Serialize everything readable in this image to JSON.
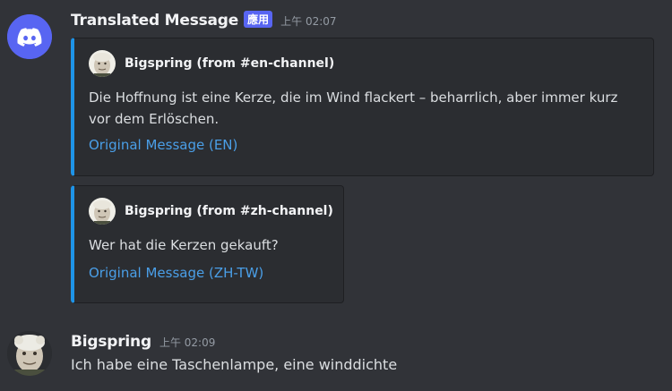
{
  "bot_message": {
    "username": "Translated Message",
    "badge": "應用",
    "timestamp": "上午 02:07",
    "avatar_icon": "discord-logo-icon",
    "embeds": [
      {
        "author": "Bigspring (from #en-channel)",
        "description": "Die Hoffnung ist eine Kerze, die im Wind flackert – beharrlich, aber immer kurz vor dem Erlöschen.",
        "link_text": "Original Message (EN)",
        "accent_color": "#1e94e8"
      },
      {
        "author": "Bigspring (from #zh-channel)",
        "description": "Wer hat die Kerzen gekauft?",
        "link_text": "Original Message (ZH-TW)",
        "accent_color": "#1e94e8"
      }
    ]
  },
  "user_message": {
    "username": "Bigspring",
    "timestamp": "上午 02:09",
    "content": "Ich habe eine Taschenlampe, eine winddichte"
  },
  "colors": {
    "background": "#313338",
    "embed_background": "#2b2d31",
    "link": "#4a9fe8",
    "badge": "#5865f2"
  }
}
